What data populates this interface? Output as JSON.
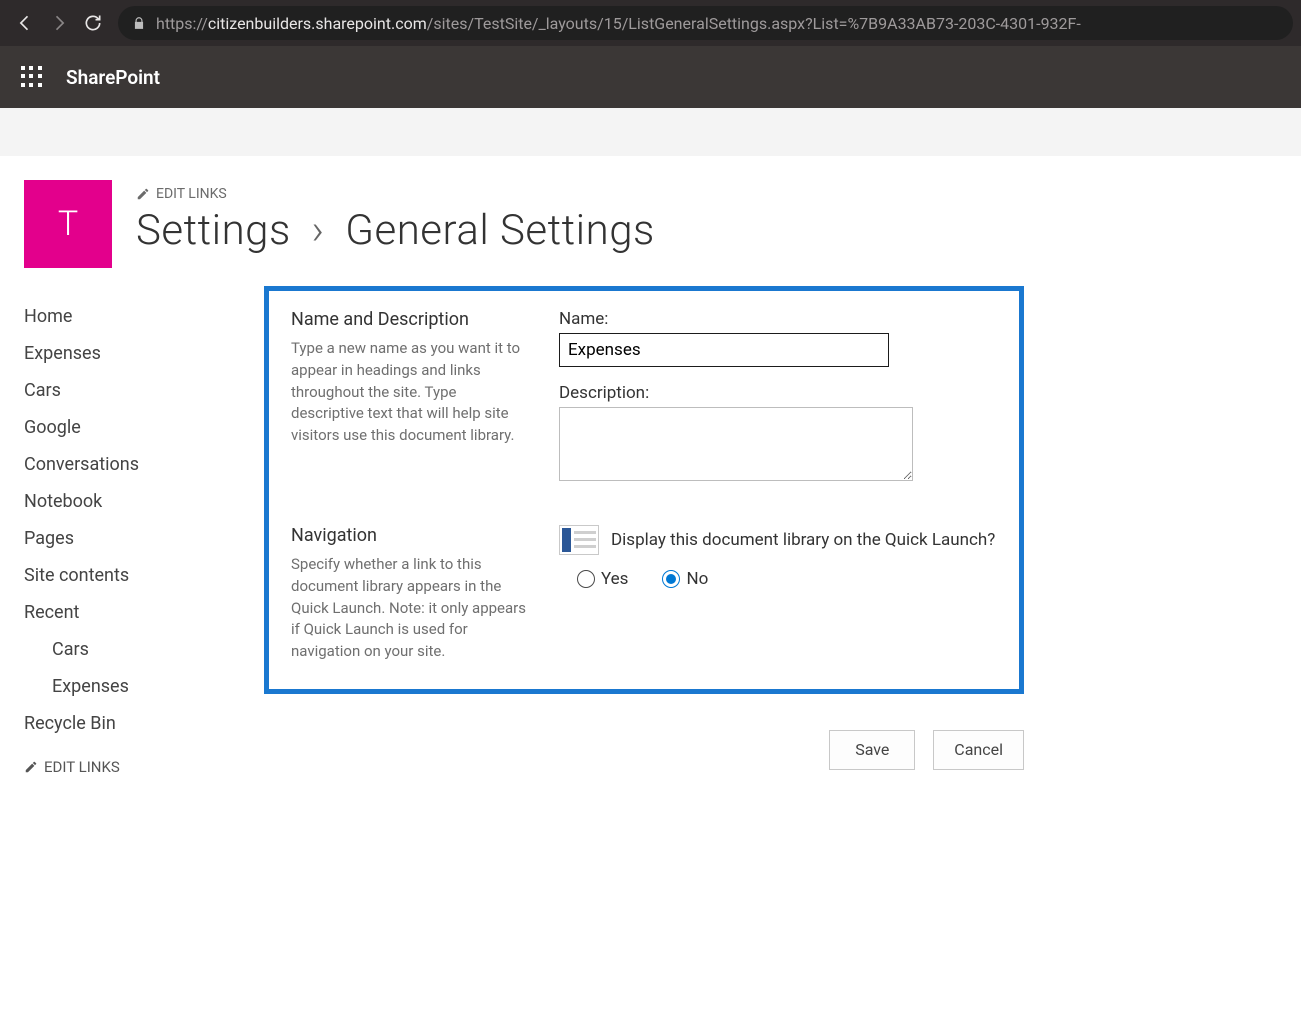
{
  "browser": {
    "url_prefix": "https://",
    "url_host": "citizenbuilders.sharepoint.com",
    "url_path": "/sites/TestSite/_layouts/15/ListGeneralSettings.aspx?List=%7B9A33AB73-203C-4301-932F-"
  },
  "suite": {
    "title": "SharePoint"
  },
  "header": {
    "site_logo_letter": "T",
    "edit_links_label": "EDIT LINKS",
    "breadcrumb_root": "Settings",
    "breadcrumb_current": "General Settings"
  },
  "leftnav": {
    "items": [
      {
        "label": "Home"
      },
      {
        "label": "Expenses"
      },
      {
        "label": "Cars"
      },
      {
        "label": "Google"
      },
      {
        "label": "Conversations"
      },
      {
        "label": "Notebook"
      },
      {
        "label": "Pages"
      },
      {
        "label": "Site contents"
      },
      {
        "label": "Recent"
      },
      {
        "label": "Cars",
        "indent": true
      },
      {
        "label": "Expenses",
        "indent": true
      },
      {
        "label": "Recycle Bin"
      }
    ],
    "edit_links_label": "EDIT LINKS"
  },
  "form": {
    "section_name": {
      "title": "Name and Description",
      "help": "Type a new name as you want it to appear in headings and links throughout the site. Type descriptive text that will help site visitors use this document library.",
      "name_label": "Name:",
      "name_value": "Expenses",
      "description_label": "Description:",
      "description_value": ""
    },
    "section_nav": {
      "title": "Navigation",
      "help": "Specify whether a link to this document library appears in the Quick Launch. Note: it only appears if Quick Launch is used for navigation on your site.",
      "question": "Display this document library on the Quick Launch?",
      "option_yes": "Yes",
      "option_no": "No",
      "selected": "No"
    },
    "buttons": {
      "save": "Save",
      "cancel": "Cancel"
    }
  }
}
